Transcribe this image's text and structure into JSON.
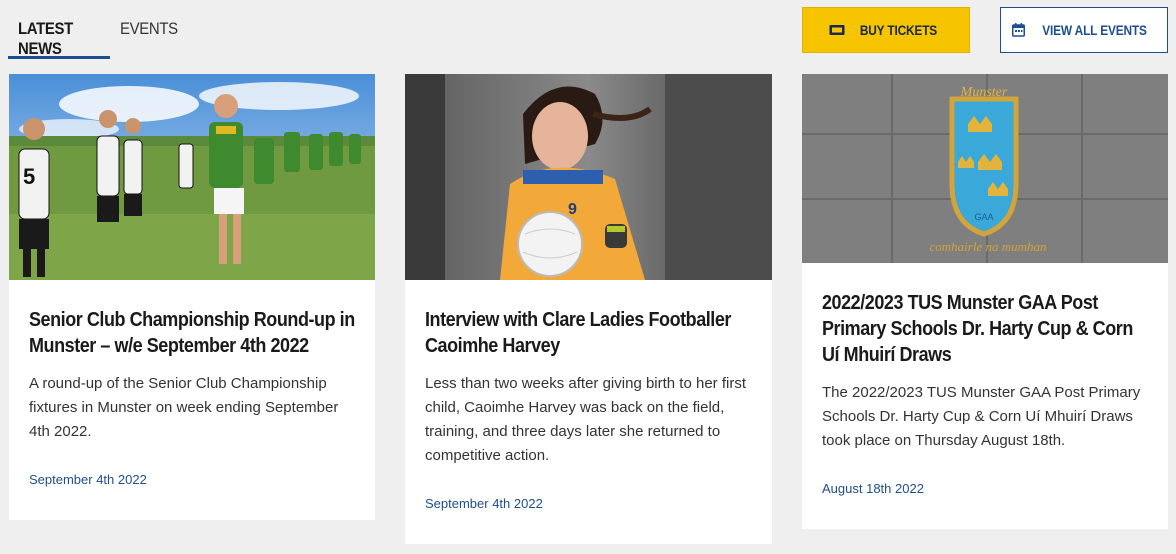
{
  "tabs": {
    "latest_news": "LATEST NEWS",
    "events": "EVENTS"
  },
  "actions": {
    "buy_tickets": "BUY TICKETS",
    "view_all_events": "VIEW ALL EVENTS"
  },
  "colors": {
    "accent_blue": "#1d4e8f",
    "ticket_yellow": "#f6c400"
  },
  "articles": [
    {
      "title": "Senior Club Championship Round-up in Munster – w/e September 4th 2022",
      "description": "A round-up of the Senior Club Championship fixtures in Munster on week ending September 4th 2022.",
      "date": "September 4th 2022"
    },
    {
      "title": "Interview with Clare Ladies Footballer Caoimhe Harvey",
      "description": "Less than two weeks after giving birth to her first child, Caoimhe Harvey was back on the field, training, and three days later she returned to competitive action.",
      "date": "September 4th 2022",
      "jersey_number": "9"
    },
    {
      "title": "2022/2023 TUS Munster GAA Post Primary Schools Dr. Harty Cup & Corn Uí Mhuirí Draws",
      "description": "The 2022/2023 TUS Munster GAA Post Primary Schools Dr. Harty Cup & Corn Uí Mhuirí Draws took place on Thursday August 18th.",
      "date": "August 18th 2022",
      "crest_top": "Munster",
      "crest_mid": "GAA",
      "crest_bottom": "comhairle na mumhan"
    }
  ]
}
